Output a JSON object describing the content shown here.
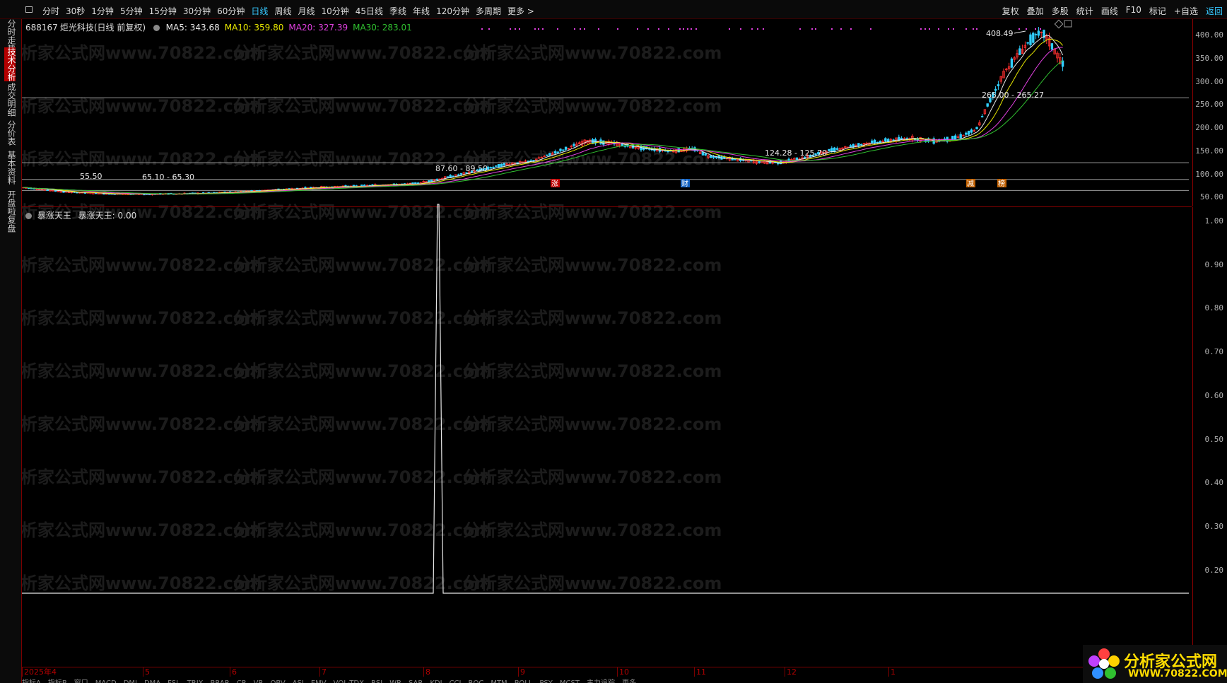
{
  "toolbar": {
    "periods": [
      "分时",
      "30秒",
      "1分钟",
      "5分钟",
      "15分钟",
      "30分钟",
      "60分钟",
      "日线",
      "周线",
      "月线",
      "10分钟",
      "45日线",
      "季线",
      "年线",
      "120分钟",
      "多周期",
      "更多 >"
    ],
    "active_period": "日线",
    "tools": [
      "复权",
      "叠加",
      "多股",
      "统计",
      "画线",
      "F10",
      "标记",
      "+自选",
      "返回"
    ]
  },
  "sidebar": {
    "tabs": [
      {
        "label": "分时走势",
        "active": false
      },
      {
        "label": "技术分析",
        "active": true
      },
      {
        "label": "成交明细",
        "active": false
      },
      {
        "label": "分价表",
        "active": false
      },
      {
        "label": "基本资料",
        "active": false
      },
      {
        "label": "开盘啦复盘",
        "active": false
      }
    ]
  },
  "main_chart": {
    "stock_code": "688167",
    "stock_name": "炬光科技",
    "mode": "(日线 前复权)",
    "ma": [
      {
        "label": "MA5: 343.68",
        "color": "#e8e8e8"
      },
      {
        "label": "MA10: 359.80",
        "color": "#e6e600"
      },
      {
        "label": "MA20: 327.39",
        "color": "#e040e0"
      },
      {
        "label": "MA30: 283.01",
        "color": "#30c030"
      }
    ],
    "annotations": [
      "55.50",
      "65.10 - 65.30",
      "87.60 - 89.50",
      "124.28 - 125.70",
      "265.00 - 265.27",
      "408.49"
    ],
    "markers": [
      "涨",
      "财",
      "减",
      "榜"
    ],
    "y_ticks": [
      "400.00",
      "350.00",
      "300.00",
      "250.00",
      "200.00",
      "150.00",
      "100.00",
      "50.00"
    ]
  },
  "indicator": {
    "name": "暴涨天王",
    "value_label": "暴涨天王: 0.00",
    "y_ticks": [
      "1.00",
      "0.90",
      "0.80",
      "0.70",
      "0.60",
      "0.50",
      "0.40",
      "0.30",
      "0.20"
    ]
  },
  "x_axis": {
    "labels": [
      "2025年4",
      "5",
      "6",
      "7",
      "8",
      "9",
      "10",
      "11",
      "12",
      "1"
    ]
  },
  "bottom_tabs": [
    "指标A",
    "指标B",
    "窗口",
    "MACD",
    "DMI",
    "DMA",
    "FSL",
    "TRIX",
    "BRAR",
    "CR",
    "VR",
    "OBV",
    "ASI",
    "EMV",
    "VOL-TDX",
    "RSI",
    "WR",
    "SAR",
    "KDJ",
    "CCI",
    "ROC",
    "MTM",
    "BOLL",
    "PSY",
    "MCST",
    "主力追踪",
    "更多"
  ],
  "watermark": "分析家公式网www.70822.com",
  "brand": {
    "title": "分析家公式网",
    "url": "WWW.70822.COM"
  },
  "colors": {
    "up": "#ff3030",
    "down": "#30d0ff",
    "accent": "#37c8ff",
    "grid_red": "#8a0000"
  }
}
